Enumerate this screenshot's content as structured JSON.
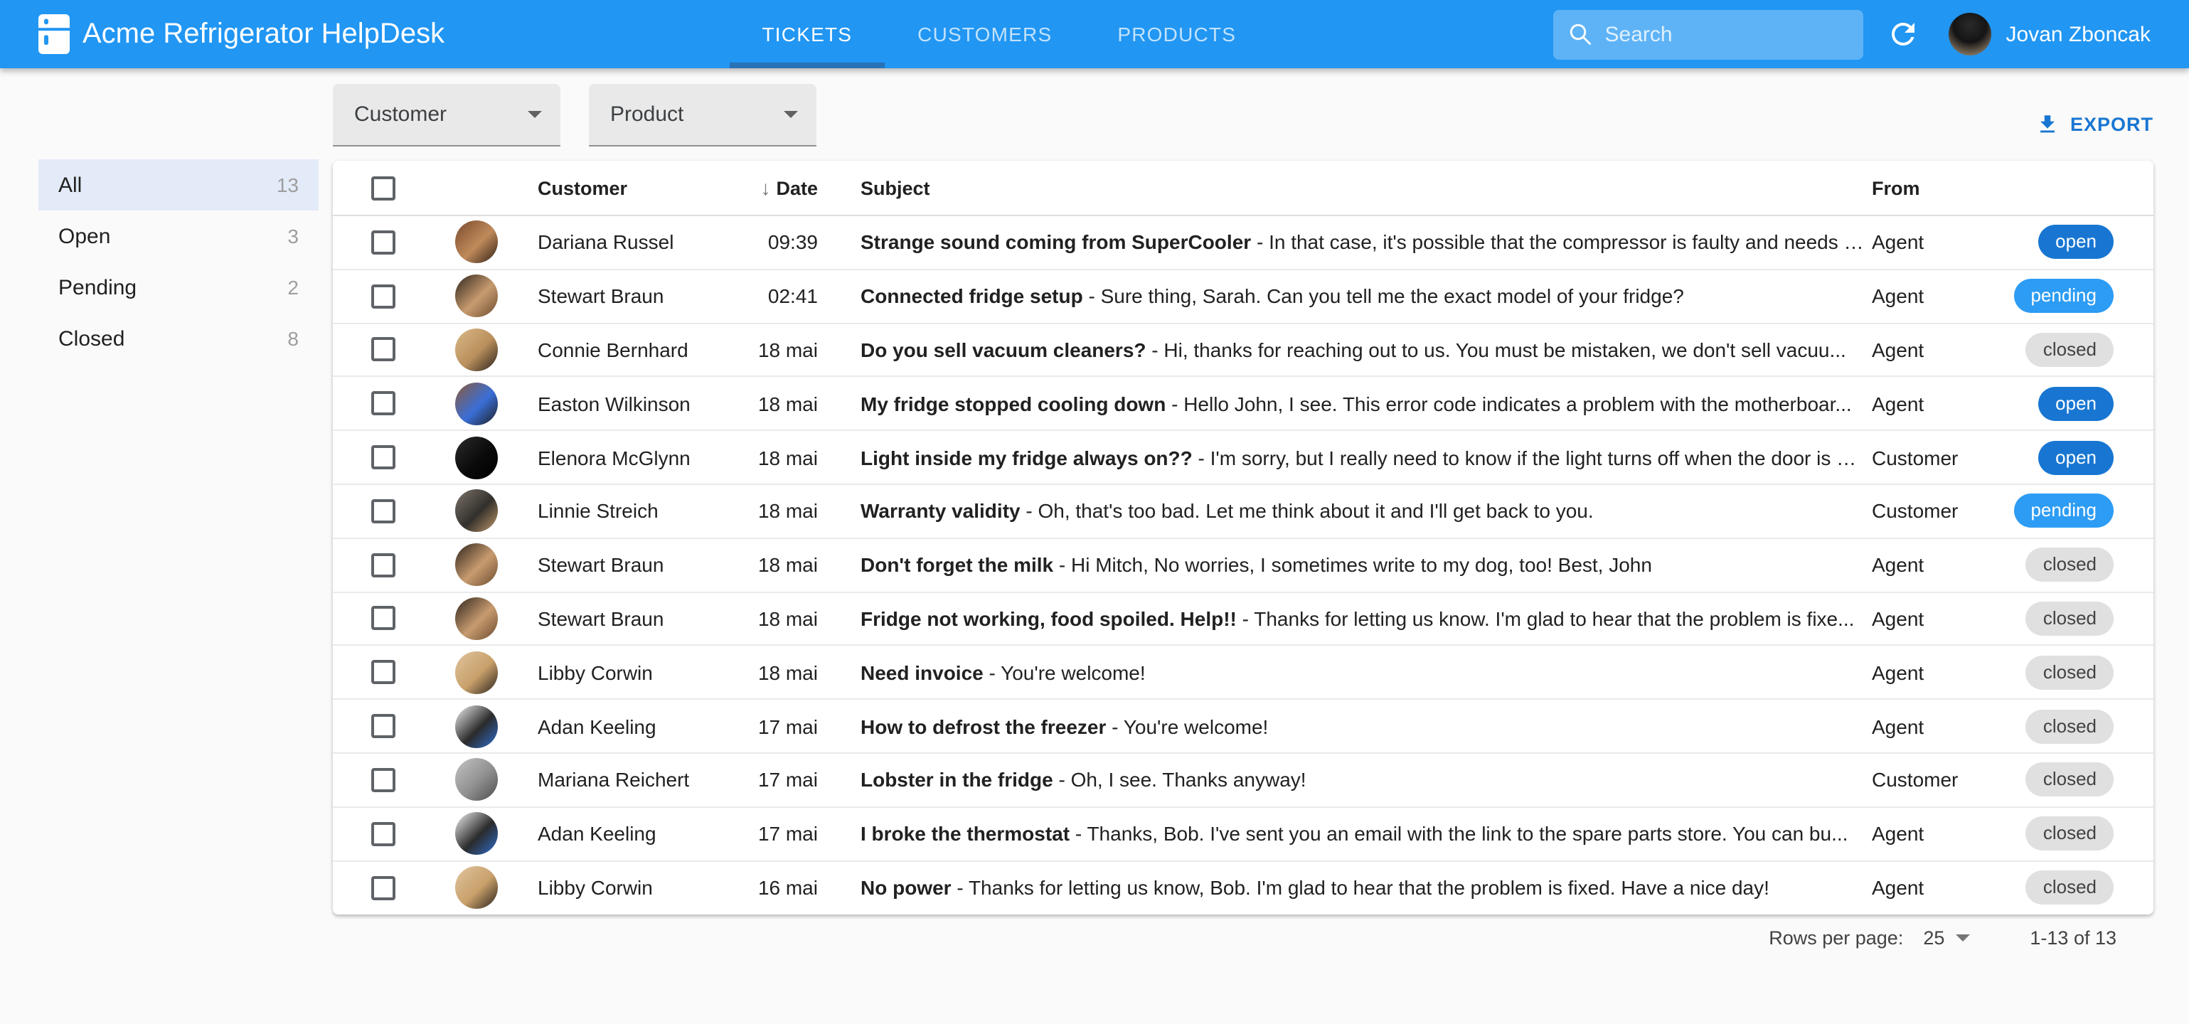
{
  "appbar": {
    "title": "Acme Refrigerator HelpDesk",
    "tabs": [
      {
        "label": "TICKETS",
        "active": true
      },
      {
        "label": "CUSTOMERS",
        "active": false
      },
      {
        "label": "PRODUCTS",
        "active": false
      }
    ],
    "search_placeholder": "Search",
    "user_name": "Jovan Zboncak",
    "colors": {
      "bar": "#2196f3",
      "tab_indicator": "#2a72b8"
    }
  },
  "sidebar": {
    "items": [
      {
        "label": "All",
        "count": "13",
        "selected": true
      },
      {
        "label": "Open",
        "count": "3",
        "selected": false
      },
      {
        "label": "Pending",
        "count": "2",
        "selected": false
      },
      {
        "label": "Closed",
        "count": "8",
        "selected": false
      }
    ]
  },
  "filters": {
    "customer_label": "Customer",
    "product_label": "Product"
  },
  "export_label": "EXPORT",
  "table": {
    "headers": {
      "customer": "Customer",
      "date": "Date",
      "subject": "Subject",
      "from": "From"
    },
    "rows": [
      {
        "customer": "Dariana Russel",
        "date": "09:39",
        "subject": "Strange sound coming from SuperCooler",
        "preview": "- In that case, it's possible that the compressor is faulty and needs …",
        "from": "Agent",
        "status": "open",
        "avatar_colors": [
          "#7a4a2e",
          "#c08a5a",
          "#2e1f16"
        ]
      },
      {
        "customer": "Stewart Braun",
        "date": "02:41",
        "subject": "Connected fridge setup",
        "preview": "- Sure thing, Sarah. Can you tell me the exact model of your fridge?",
        "from": "Agent",
        "status": "pending",
        "avatar_colors": [
          "#2e241c",
          "#c79b6f",
          "#6b4a2e"
        ]
      },
      {
        "customer": "Connie Bernhard",
        "date": "18 mai",
        "subject": "Do you sell vacuum cleaners?",
        "preview": "- Hi, thanks for reaching out to us. You must be mistaken, we don't sell vacuu...",
        "from": "Agent",
        "status": "closed",
        "avatar_colors": [
          "#d9b987",
          "#b98f5c",
          "#26201a"
        ]
      },
      {
        "customer": "Easton Wilkinson",
        "date": "18 mai",
        "subject": "My fridge stopped cooling down",
        "preview": "- Hello John, I see. This error code indicates a problem with the motherboar...",
        "from": "Agent",
        "status": "open",
        "avatar_colors": [
          "#8a5a38",
          "#3a6fd8",
          "#1d1d1d"
        ]
      },
      {
        "customer": "Elenora McGlynn",
        "date": "18 mai",
        "subject": "Light inside my fridge always on??",
        "preview": "- I'm sorry, but I really need to know if the light turns off when the door is …",
        "from": "Customer",
        "status": "open",
        "avatar_colors": [
          "#2b2b2b",
          "#0a0a0a",
          "#000000"
        ]
      },
      {
        "customer": "Linnie Streich",
        "date": "18 mai",
        "subject": "Warranty validity",
        "preview": "- Oh, that's too bad. Let me think about it and I'll get back to you.",
        "from": "Customer",
        "status": "pending",
        "avatar_colors": [
          "#7d746a",
          "#32302c",
          "#c29a6c"
        ]
      },
      {
        "customer": "Stewart Braun",
        "date": "18 mai",
        "subject": "Don't forget the milk",
        "preview": "- Hi Mitch, No worries, I sometimes write to my dog, too! Best, John",
        "from": "Agent",
        "status": "closed",
        "avatar_colors": [
          "#2e241c",
          "#c79b6f",
          "#6b4a2e"
        ]
      },
      {
        "customer": "Stewart Braun",
        "date": "18 mai",
        "subject": "Fridge not working, food spoiled. Help!!",
        "preview": "- Thanks for letting us know. I'm glad to hear that the problem is fixe...",
        "from": "Agent",
        "status": "closed",
        "avatar_colors": [
          "#2e241c",
          "#c79b6f",
          "#6b4a2e"
        ]
      },
      {
        "customer": "Libby Corwin",
        "date": "18 mai",
        "subject": "Need invoice",
        "preview": "- You're welcome!",
        "from": "Agent",
        "status": "closed",
        "avatar_colors": [
          "#e0c49e",
          "#c8a06a",
          "#262019"
        ]
      },
      {
        "customer": "Adan Keeling",
        "date": "17 mai",
        "subject": "How to defrost the freezer",
        "preview": "- You're welcome!",
        "from": "Agent",
        "status": "closed",
        "avatar_colors": [
          "#f2f2f2",
          "#2b2b2b",
          "#2f6fd0"
        ]
      },
      {
        "customer": "Mariana Reichert",
        "date": "17 mai",
        "subject": "Lobster in the fridge",
        "preview": "- Oh, I see. Thanks anyway!",
        "from": "Customer",
        "status": "closed",
        "avatar_colors": [
          "#c4c4c4",
          "#8f8f8f",
          "#4c4c4c"
        ]
      },
      {
        "customer": "Adan Keeling",
        "date": "17 mai",
        "subject": "I broke the thermostat",
        "preview": "- Thanks, Bob. I've sent you an email with the link to the spare parts store. You can bu...",
        "from": "Agent",
        "status": "closed",
        "avatar_colors": [
          "#f2f2f2",
          "#2b2b2b",
          "#2f6fd0"
        ]
      },
      {
        "customer": "Libby Corwin",
        "date": "16 mai",
        "subject": "No power",
        "preview": "- Thanks for letting us know, Bob. I'm glad to hear that the problem is fixed. Have a nice day!",
        "from": "Agent",
        "status": "closed",
        "avatar_colors": [
          "#e0c49e",
          "#c8a06a",
          "#262019"
        ]
      }
    ]
  },
  "pagination": {
    "rows_per_page_label": "Rows per page:",
    "rows_per_page_value": "25",
    "range": "1-13 of 13"
  },
  "status_colors": {
    "open": "#1876d2",
    "pending": "#2d9cf4",
    "closed": "#e0e0e0"
  }
}
